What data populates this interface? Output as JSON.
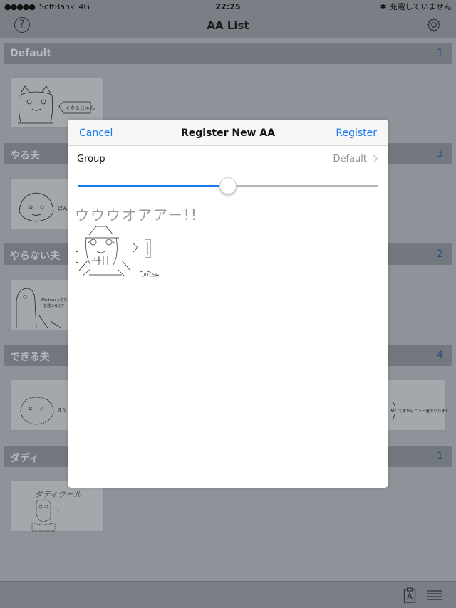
{
  "status_bar": {
    "signal": "●●●●●",
    "carrier": "SoftBank",
    "network": "4G",
    "time": "22:25",
    "bluetooth": "✱",
    "battery": "充電していません"
  },
  "nav": {
    "title": "AA List",
    "help_icon": "?"
  },
  "sections": [
    {
      "title": "Default",
      "count": "1"
    },
    {
      "title": "やる夫",
      "count": "3"
    },
    {
      "title": "やらない夫",
      "count": "2"
    },
    {
      "title": "できる夫",
      "count": "4"
    },
    {
      "title": "ダディ",
      "count": "1"
    }
  ],
  "thumb_texts": {
    "default_1": "＜やるじゃん",
    "yaruo_1": "ほんとは",
    "yaranaio_1": "Windowsってなてもら",
    "yaranaio_1b": "普通に考えて",
    "dekiruo_1": "また",
    "dekiruo_4": "ですからニュー速でやりましょう",
    "daddy_1": "ダディクール"
  },
  "modal": {
    "cancel_label": "Cancel",
    "title": "Register New AA",
    "register_label": "Register",
    "group_label": "Group",
    "group_value": "Default",
    "slider_value": 0.5,
    "aa_heading": "ウウウオアアー!!"
  },
  "colors": {
    "accent": "#1a7cf2",
    "dimmed_background": "#8e939a"
  }
}
